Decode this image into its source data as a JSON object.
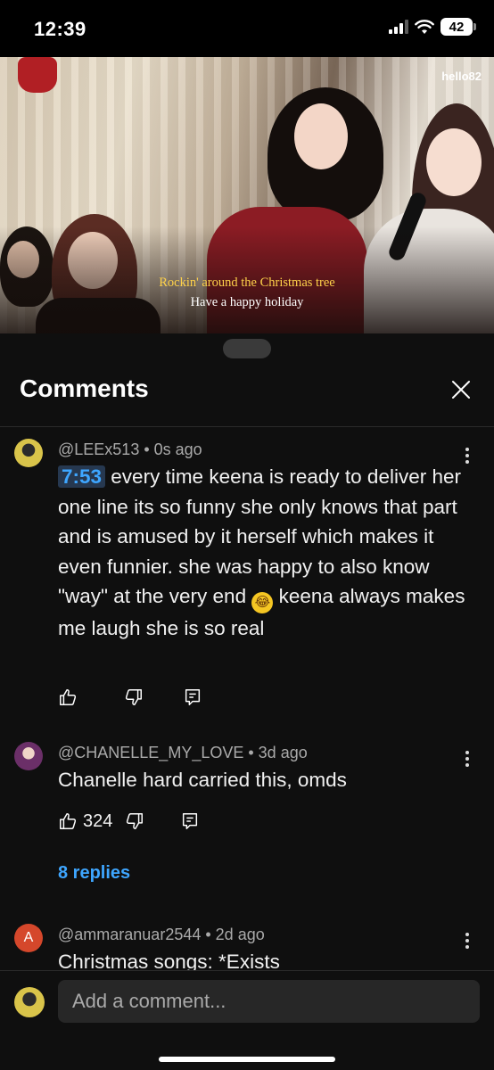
{
  "status_bar": {
    "time": "12:39",
    "battery": "42",
    "icons": [
      "cellular-signal-icon",
      "wifi-icon",
      "battery-icon"
    ]
  },
  "video": {
    "watermark": "hello82",
    "subtitle_line1": "Rockin' around the Christmas tree",
    "subtitle_line2": "Have a happy holiday"
  },
  "comments_sheet": {
    "title": "Comments",
    "comments": [
      {
        "author": "@LEEx513",
        "age": "0s ago",
        "timestamp_chip": "7:53",
        "text_part1": " every time keena is ready to deliver her one line its so funny she only knows that part and is amused by it herself which makes it even funnier. she was happy to also know \"way\" at the very end ",
        "emoji": "😂",
        "text_part2": " keena always makes me laugh she is so real",
        "likes": ""
      },
      {
        "author": "@CHANELLE_MY_LOVE",
        "age": "3d ago",
        "text": "Chanelle hard carried this, omds",
        "likes": "324",
        "replies": "8 replies"
      },
      {
        "author": "@ammaranuar2544",
        "age": "2d ago",
        "avatar_letter": "A",
        "text": "Christmas songs: *Exists"
      }
    ]
  },
  "comment_box": {
    "placeholder": "Add a comment..."
  },
  "colors": {
    "background": "#0f0f0f",
    "link_blue": "#3ea6ff",
    "input_bg": "#272727",
    "subtitle_yellow": "#ffd24a"
  }
}
